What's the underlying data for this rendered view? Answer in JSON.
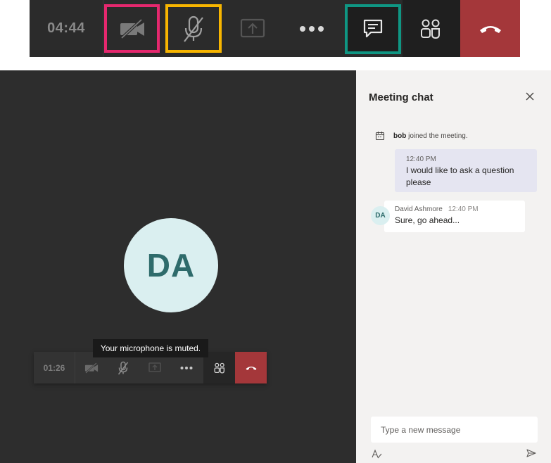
{
  "top_bar": {
    "timer": "04:44",
    "buttons": [
      "camera-off",
      "mic-off",
      "share",
      "more",
      "chat",
      "people",
      "hang-up"
    ],
    "highlight_colors": {
      "camera": "#e5286e",
      "mic": "#f7b500",
      "chat": "#0f9683"
    },
    "hangup_color": "#a4373a"
  },
  "stage": {
    "avatar_initials": "DA",
    "tooltip": "Your microphone is muted.",
    "mini_timer": "01:26"
  },
  "chat": {
    "title": "Meeting chat",
    "system_user": "bob",
    "system_text": " joined the meeting.",
    "my_message": {
      "time": "12:40 PM",
      "text": "I would like to ask a question please"
    },
    "other_message": {
      "initials": "DA",
      "author": "David Ashmore",
      "time": "12:40 PM",
      "text": "Sure, go ahead..."
    },
    "compose_placeholder": "Type a new message"
  }
}
